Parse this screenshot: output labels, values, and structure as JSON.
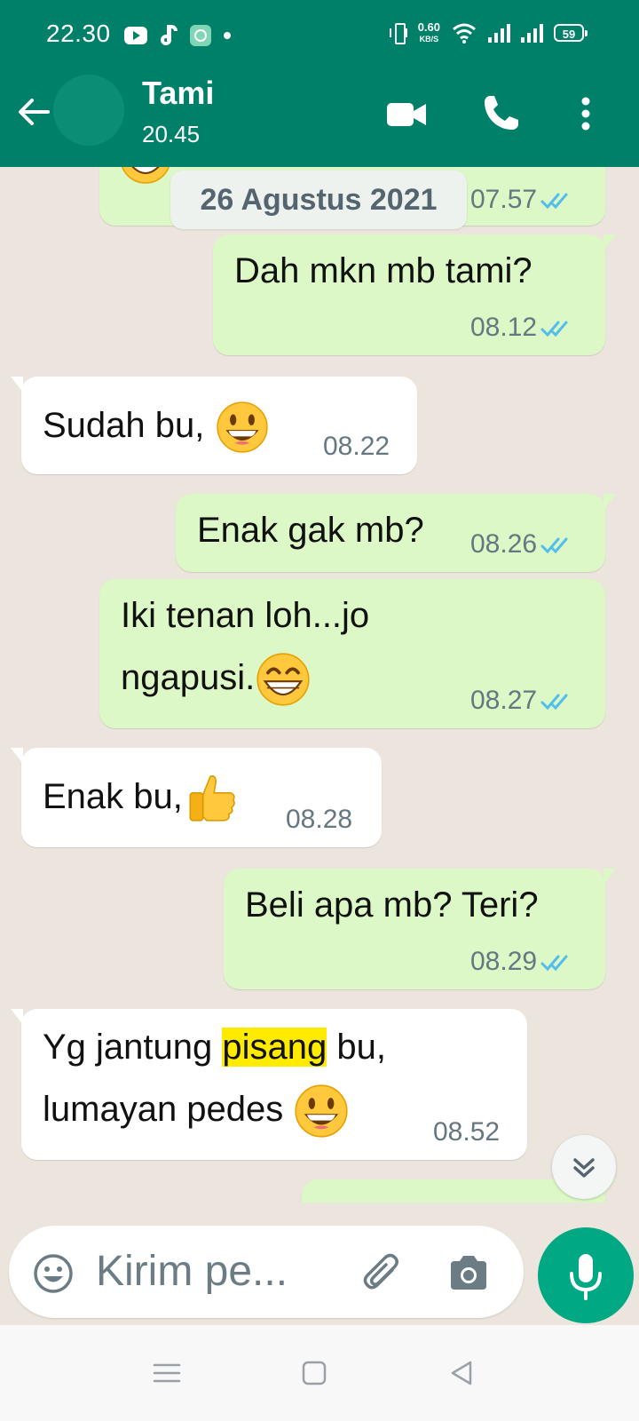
{
  "status_bar": {
    "time": "22.30",
    "net_speed": "0.60",
    "net_speed_unit": "KB/S",
    "battery": "59"
  },
  "header": {
    "contact_name": "Tami",
    "subtitle": "20.45"
  },
  "date_label": "26 Agustus 2021",
  "messages": [
    {
      "dir": "out",
      "time": "07.57"
    },
    {
      "dir": "out",
      "text": "Dah mkn mb tami?",
      "time": "08.12"
    },
    {
      "dir": "in",
      "text": "Sudah bu,",
      "emoji": "grinning",
      "time": "08.22"
    },
    {
      "dir": "out",
      "text": "Enak gak mb?",
      "time": "08.26"
    },
    {
      "dir": "out",
      "line1": "Iki tenan loh...jo",
      "line2": "ngapusi.",
      "emoji": "beaming",
      "time": "08.27"
    },
    {
      "dir": "in",
      "text": "Enak bu,",
      "emoji": "thumbs-up",
      "time": "08.28"
    },
    {
      "dir": "out",
      "text": "Beli apa mb? Teri?",
      "time": "08.29"
    },
    {
      "dir": "in",
      "line1_a": "Yg jantung ",
      "line1_hl": "pisang",
      "line1_b": " bu,",
      "line2": "lumayan pedes ",
      "emoji": "grinning",
      "time": "08.52"
    }
  ],
  "composer": {
    "placeholder": "Kirim pe..."
  },
  "colors": {
    "header": "#008069",
    "outgoing_bubble": "#DCF8C6",
    "incoming_bubble": "#FFFFFF",
    "chat_background": "#ECE5DD",
    "read_ticks": "#53BDEB",
    "mic_button": "#00A884",
    "search_highlight": "#FFEB00"
  },
  "icons": [
    "back-arrow-icon",
    "video-call-icon",
    "voice-call-icon",
    "more-options-icon",
    "emoji-icon",
    "attach-icon",
    "camera-icon",
    "mic-icon",
    "scroll-down-icon",
    "nav-menu-icon",
    "nav-home-icon",
    "nav-back-icon"
  ]
}
